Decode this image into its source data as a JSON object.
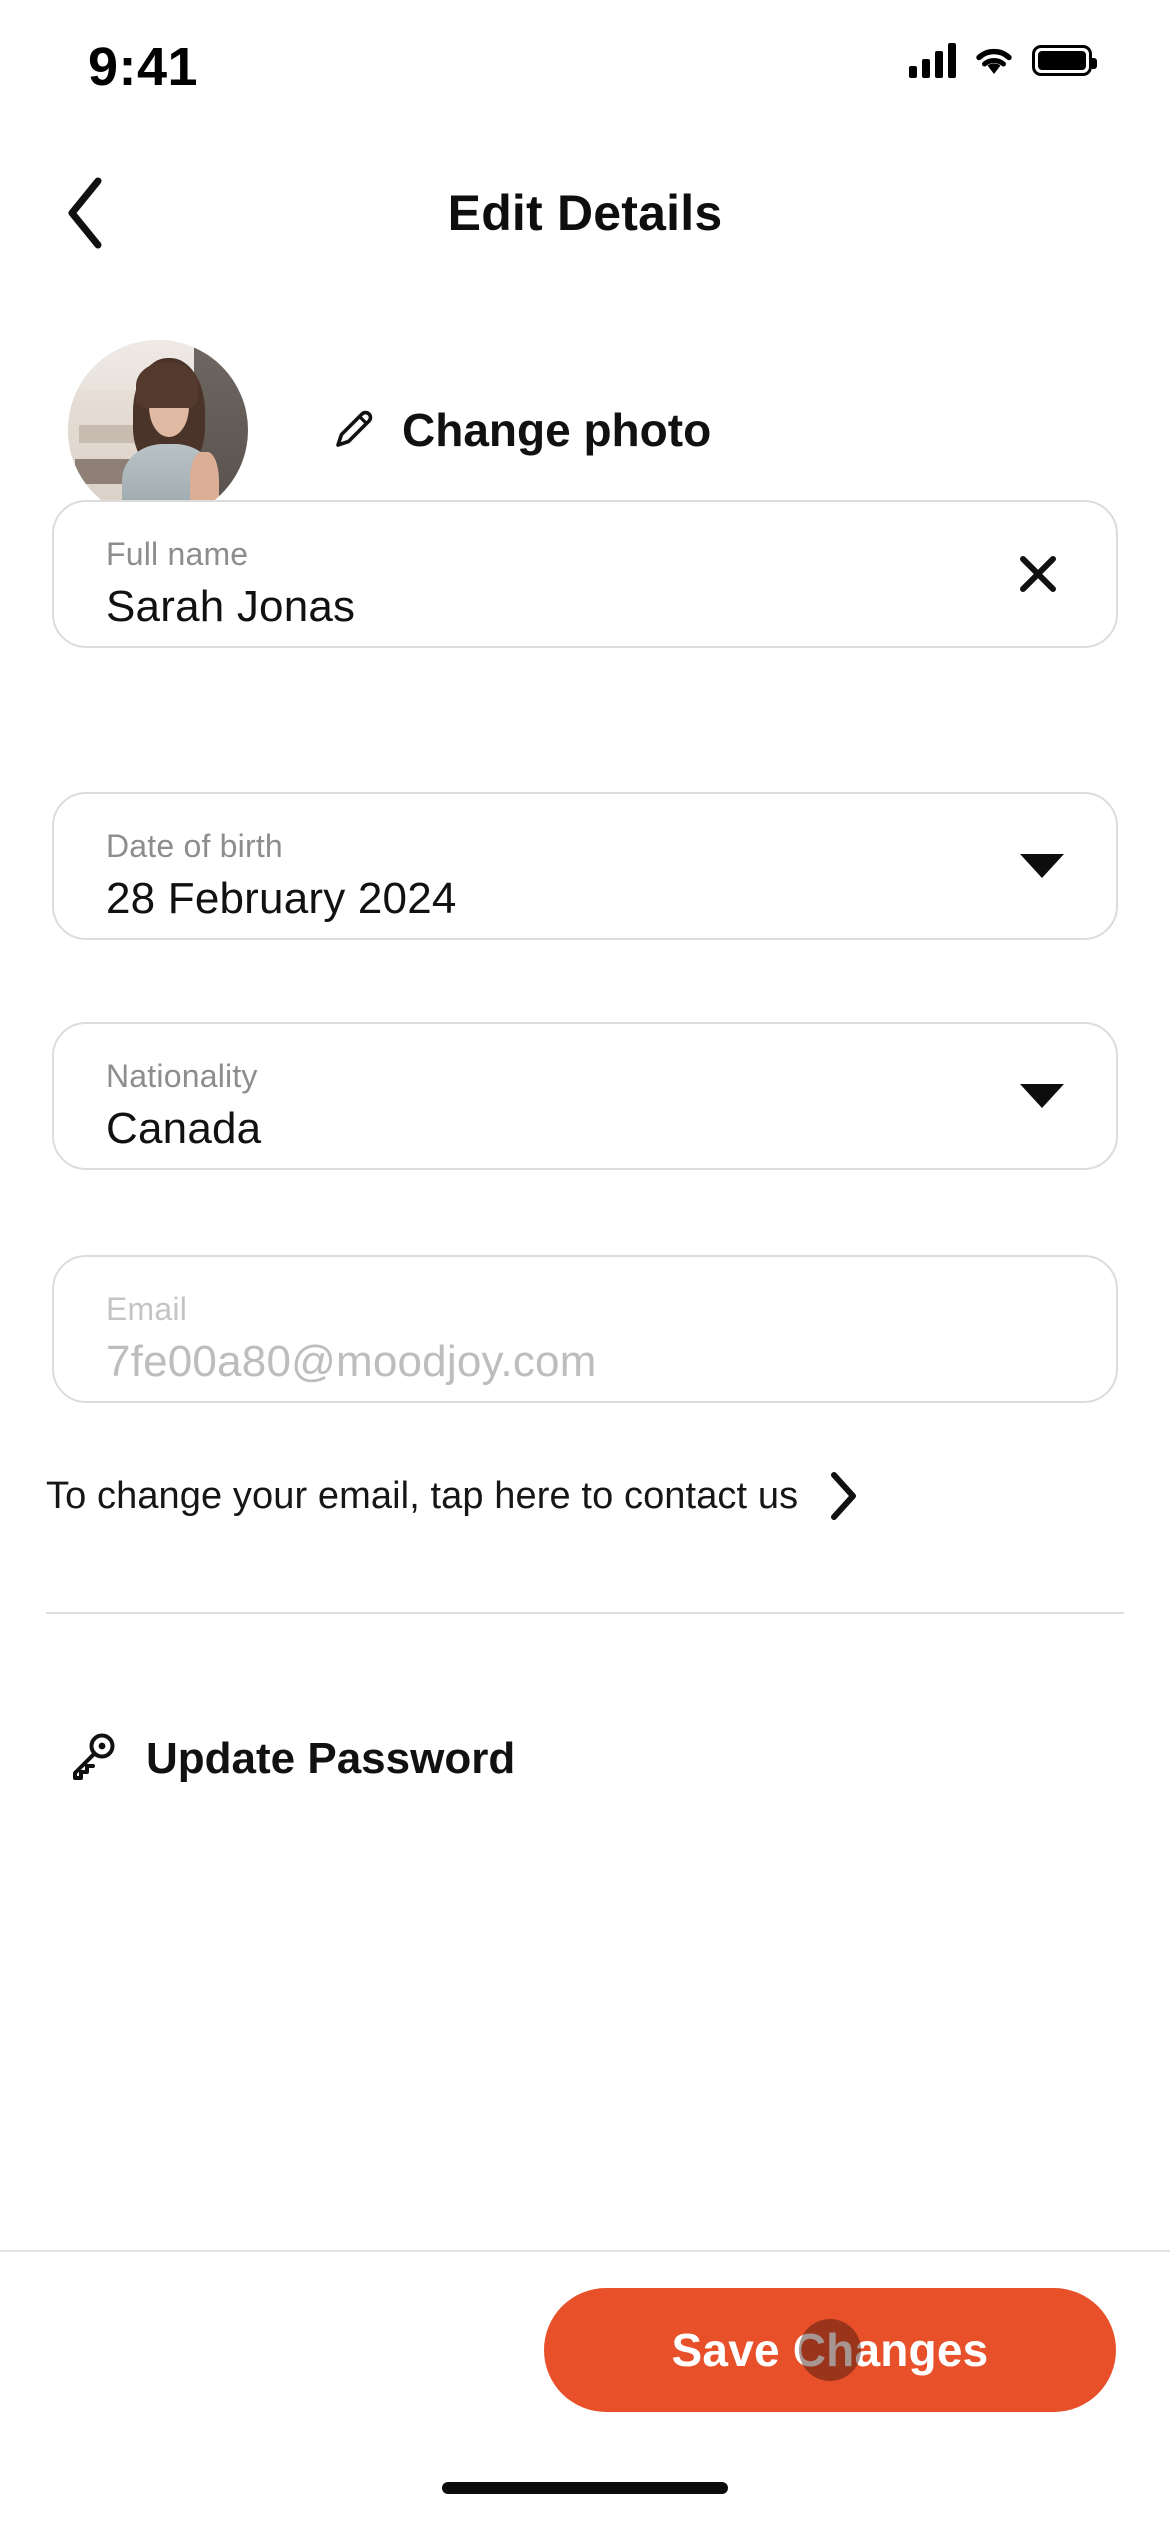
{
  "status_bar": {
    "time": "9:41",
    "signal_icon": "cellular-signal-icon",
    "wifi_icon": "wifi-icon",
    "battery_icon": "battery-full-icon"
  },
  "header": {
    "back_icon": "chevron-left-icon",
    "title": "Edit Details"
  },
  "profile": {
    "avatar_alt": "user-profile-photo",
    "edit_icon": "pencil-icon",
    "change_photo_label": "Change photo"
  },
  "form": {
    "fields": [
      {
        "key": "full_name",
        "label": "Full name",
        "value": "Sarah Jonas",
        "placeholder": "Full name",
        "trailing_icon": "close-icon",
        "disabled": false
      },
      {
        "key": "date_of_birth",
        "label": "Date of birth",
        "value": "28 February 2024",
        "placeholder": "Date of birth",
        "trailing_icon": "chevron-down-icon",
        "disabled": false
      },
      {
        "key": "nationality",
        "label": "Nationality",
        "value": "Canada",
        "placeholder": "Nationality",
        "trailing_icon": "chevron-down-icon",
        "disabled": false
      },
      {
        "key": "email",
        "label": "Email",
        "value": "7fe00a80@moodjoy.com",
        "placeholder": "Email",
        "trailing_icon": "",
        "disabled": true
      }
    ]
  },
  "contact_link": {
    "text": "To change your email, tap here to contact us",
    "chevron_icon": "chevron-right-icon"
  },
  "update_password": {
    "icon": "key-icon",
    "label": "Update Password"
  },
  "footer": {
    "save_label": "Save Changes",
    "save_color": "#E8502A",
    "tap_indicator": "touch-point-indicator"
  },
  "system": {
    "home_indicator": "home-indicator-bar"
  }
}
